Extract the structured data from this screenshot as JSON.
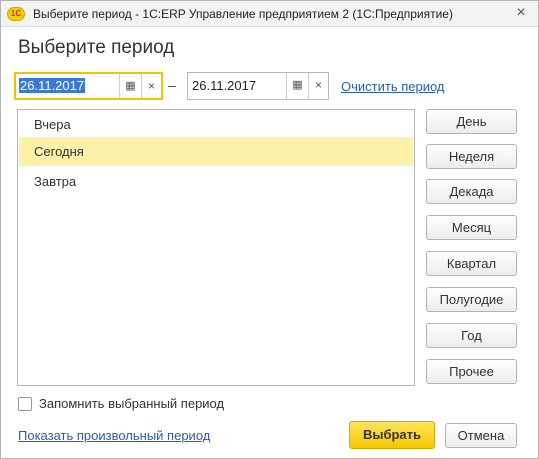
{
  "window": {
    "title": "Выберите период - 1С:ERP Управление предприятием 2  (1С:Предприятие)",
    "logo_text": "1С",
    "close_glyph": "×"
  },
  "form": {
    "heading": "Выберите период"
  },
  "date_from": {
    "value": "26.11.2017",
    "calendar_icon": "calendar-icon",
    "clear_icon": "clear-icon",
    "focused": true
  },
  "date_to": {
    "value": "26.11.2017",
    "calendar_icon": "calendar-icon",
    "clear_icon": "clear-icon"
  },
  "separator": "–",
  "clear_period_link": "Очистить период",
  "period_list": {
    "items": [
      {
        "label": "Вчера",
        "selected": false
      },
      {
        "label": "Сегодня",
        "selected": true
      },
      {
        "label": "Завтра",
        "selected": false
      }
    ],
    "selected_color": "#fbf1a9"
  },
  "period_buttons": [
    "День",
    "Неделя",
    "Декада",
    "Месяц",
    "Квартал",
    "Полугодие",
    "Год",
    "Прочее"
  ],
  "remember": {
    "label": "Запомнить выбранный период",
    "checked": false
  },
  "custom_period_link": "Показать произвольный период",
  "actions": {
    "select_label": "Выбрать",
    "cancel_label": "Отмена",
    "primary_color": "#f6c800"
  },
  "glyphs": {
    "calendar": "📅",
    "clear": "×"
  }
}
